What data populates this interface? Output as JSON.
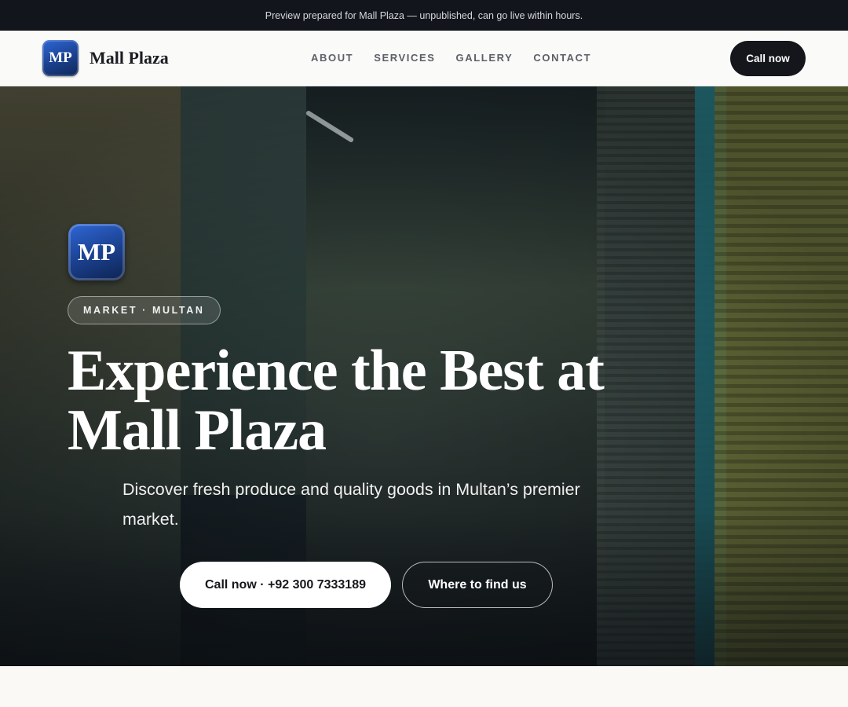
{
  "banner": {
    "text": "Preview prepared for Mall Plaza — unpublished, can go live within hours."
  },
  "nav": {
    "logo_initials": "MP",
    "brand": "Mall Plaza",
    "links": [
      "ABOUT",
      "SERVICES",
      "GALLERY",
      "CONTACT"
    ],
    "cta": "Call now"
  },
  "hero": {
    "badge_initials": "MP",
    "tag": "MARKET · MULTAN",
    "headline_line1": "Experience the Best at",
    "headline_line2": "Mall Plaza",
    "subtitle": "Discover fresh produce and quality goods in Multan’s premier market.",
    "primary_button": "Call now · +92 300 7333189",
    "secondary_button": "Where to find us"
  },
  "colors": {
    "topbar_bg": "#12151b",
    "nav_cta_bg": "#14161c",
    "logo_blue": "#1a3f8c",
    "page_bg": "#faf9f6"
  }
}
